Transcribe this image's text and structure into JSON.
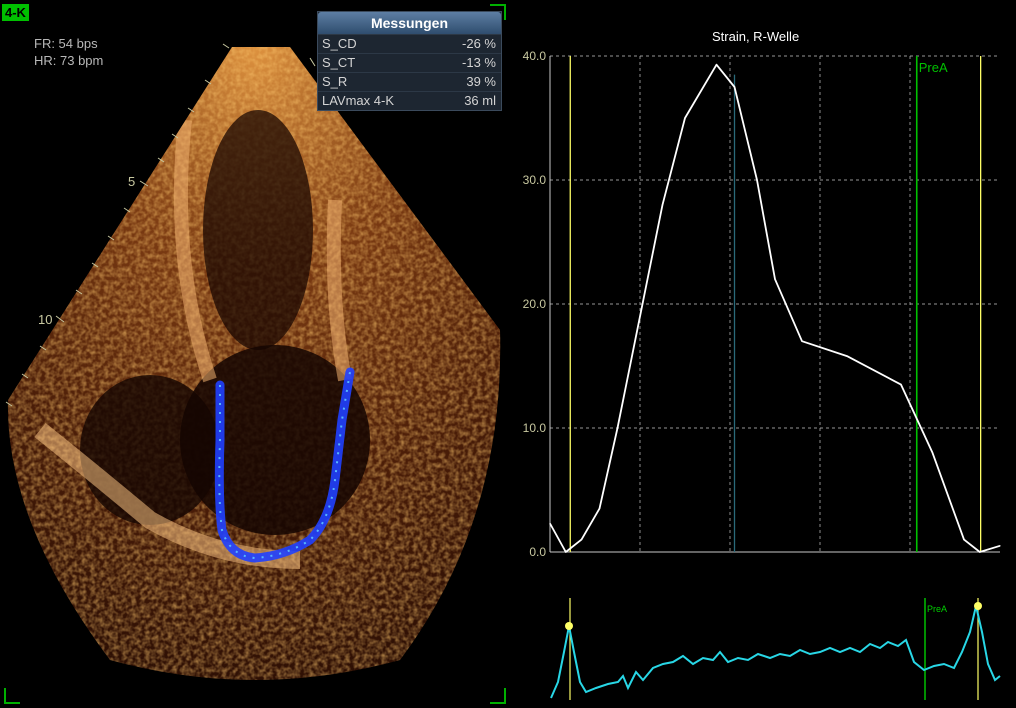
{
  "view_label": "4-K",
  "fr_text": "FR: 54 bps",
  "hr_text": "HR: 73 bpm",
  "depth_marks": [
    "5",
    "10"
  ],
  "measurements": {
    "title": "Messungen",
    "rows": [
      {
        "label": "S_CD",
        "value": "-26 %"
      },
      {
        "label": "S_CT",
        "value": "-13 %"
      },
      {
        "label": "S_R",
        "value": "39 %"
      },
      {
        "label": "LAVmax 4-K",
        "value": "36 ml"
      }
    ]
  },
  "colors": {
    "accent": "#00c000",
    "curve": "#ffffff",
    "ecg": "#28d7e6",
    "marker": "#ffff66",
    "grid": "#c8c8c8",
    "tick": "#c8c8a0"
  },
  "chart_data": {
    "type": "line",
    "title": "Strain, R-Welle",
    "ylim": [
      0,
      40
    ],
    "y_ticks": [
      "0.0",
      "10.0",
      "20.0",
      "30.0",
      "40.0"
    ],
    "x": [
      0,
      0.05,
      0.1,
      0.15,
      0.2,
      0.25,
      0.3,
      0.35,
      0.4,
      0.45,
      0.5,
      0.55,
      0.6,
      0.65,
      0.7,
      0.75,
      0.8,
      0.85,
      0.9,
      0.95,
      1.0
    ],
    "series": [
      {
        "values": [
          2.3,
          0.0,
          1.0,
          3.5,
          10.0,
          19.0,
          28.0,
          35.0,
          39.3,
          37.5,
          30.0,
          22.0,
          17.0,
          15.8,
          13.5,
          8.0,
          1.0,
          0.0,
          0.5
        ]
      }
    ],
    "markers": {
      "prea_label": "PreA",
      "peak_x": 0.41
    },
    "grid": true
  },
  "ecg": {
    "prea_label": "PreA"
  }
}
